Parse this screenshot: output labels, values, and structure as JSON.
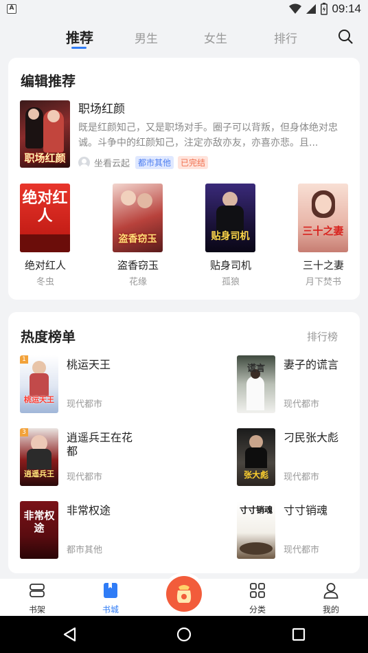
{
  "status": {
    "time": "09:14"
  },
  "tabs": [
    {
      "label": "推荐",
      "active": true
    },
    {
      "label": "男生",
      "active": false
    },
    {
      "label": "女生",
      "active": false
    },
    {
      "label": "排行",
      "active": false
    }
  ],
  "editor_pick": {
    "section_title": "编辑推荐",
    "featured": {
      "title": "职场红颜",
      "cover_text": "职场红颜",
      "description": "既是红颜知己，又是职场对手。圈子可以背叛，但身体绝对忠诚。斗争中的红颜知己，注定亦敌亦友，亦喜亦悲。且...",
      "author": "坐看云起",
      "tags": [
        "都市其他",
        "已完结"
      ]
    },
    "books": [
      {
        "title": "绝对红人",
        "author": "冬虫",
        "cover_text": "绝对红人"
      },
      {
        "title": "盗香窃玉",
        "author": "花缘",
        "cover_text": "盗香窃玉"
      },
      {
        "title": "贴身司机",
        "author": "孤狼",
        "cover_text": "贴身司机"
      },
      {
        "title": "三十之妻",
        "author": "月下焚书",
        "cover_text": "三十之妻"
      }
    ]
  },
  "hot_list": {
    "section_title": "热度榜单",
    "more_label": "排行榜",
    "items": [
      {
        "title": "桃运天王",
        "category": "现代都市",
        "cover_text": "桃运天王"
      },
      {
        "title": "妻子的谎言",
        "category": "现代都市",
        "cover_text": "谎言"
      },
      {
        "title": "逍遥兵王在花都",
        "category": "现代都市",
        "cover_text": "逍遥兵王"
      },
      {
        "title": "刁民张大彪",
        "category": "现代都市",
        "cover_text": "张大彪"
      },
      {
        "title": "非常权途",
        "category": "都市其他",
        "cover_text": "非常权途"
      },
      {
        "title": "寸寸销魂",
        "category": "现代都市",
        "cover_text": "寸寸销魂"
      }
    ]
  },
  "bottom_nav": [
    {
      "label": "书架",
      "icon": "bookshelf-icon",
      "active": false
    },
    {
      "label": "书城",
      "icon": "bookstore-icon",
      "active": true
    },
    {
      "label": "分类",
      "icon": "category-grid-icon",
      "active": false
    },
    {
      "label": "我的",
      "icon": "profile-icon",
      "active": false
    }
  ],
  "colors": {
    "accent": "#2f7cf6",
    "center_button": "#f25c3b"
  }
}
